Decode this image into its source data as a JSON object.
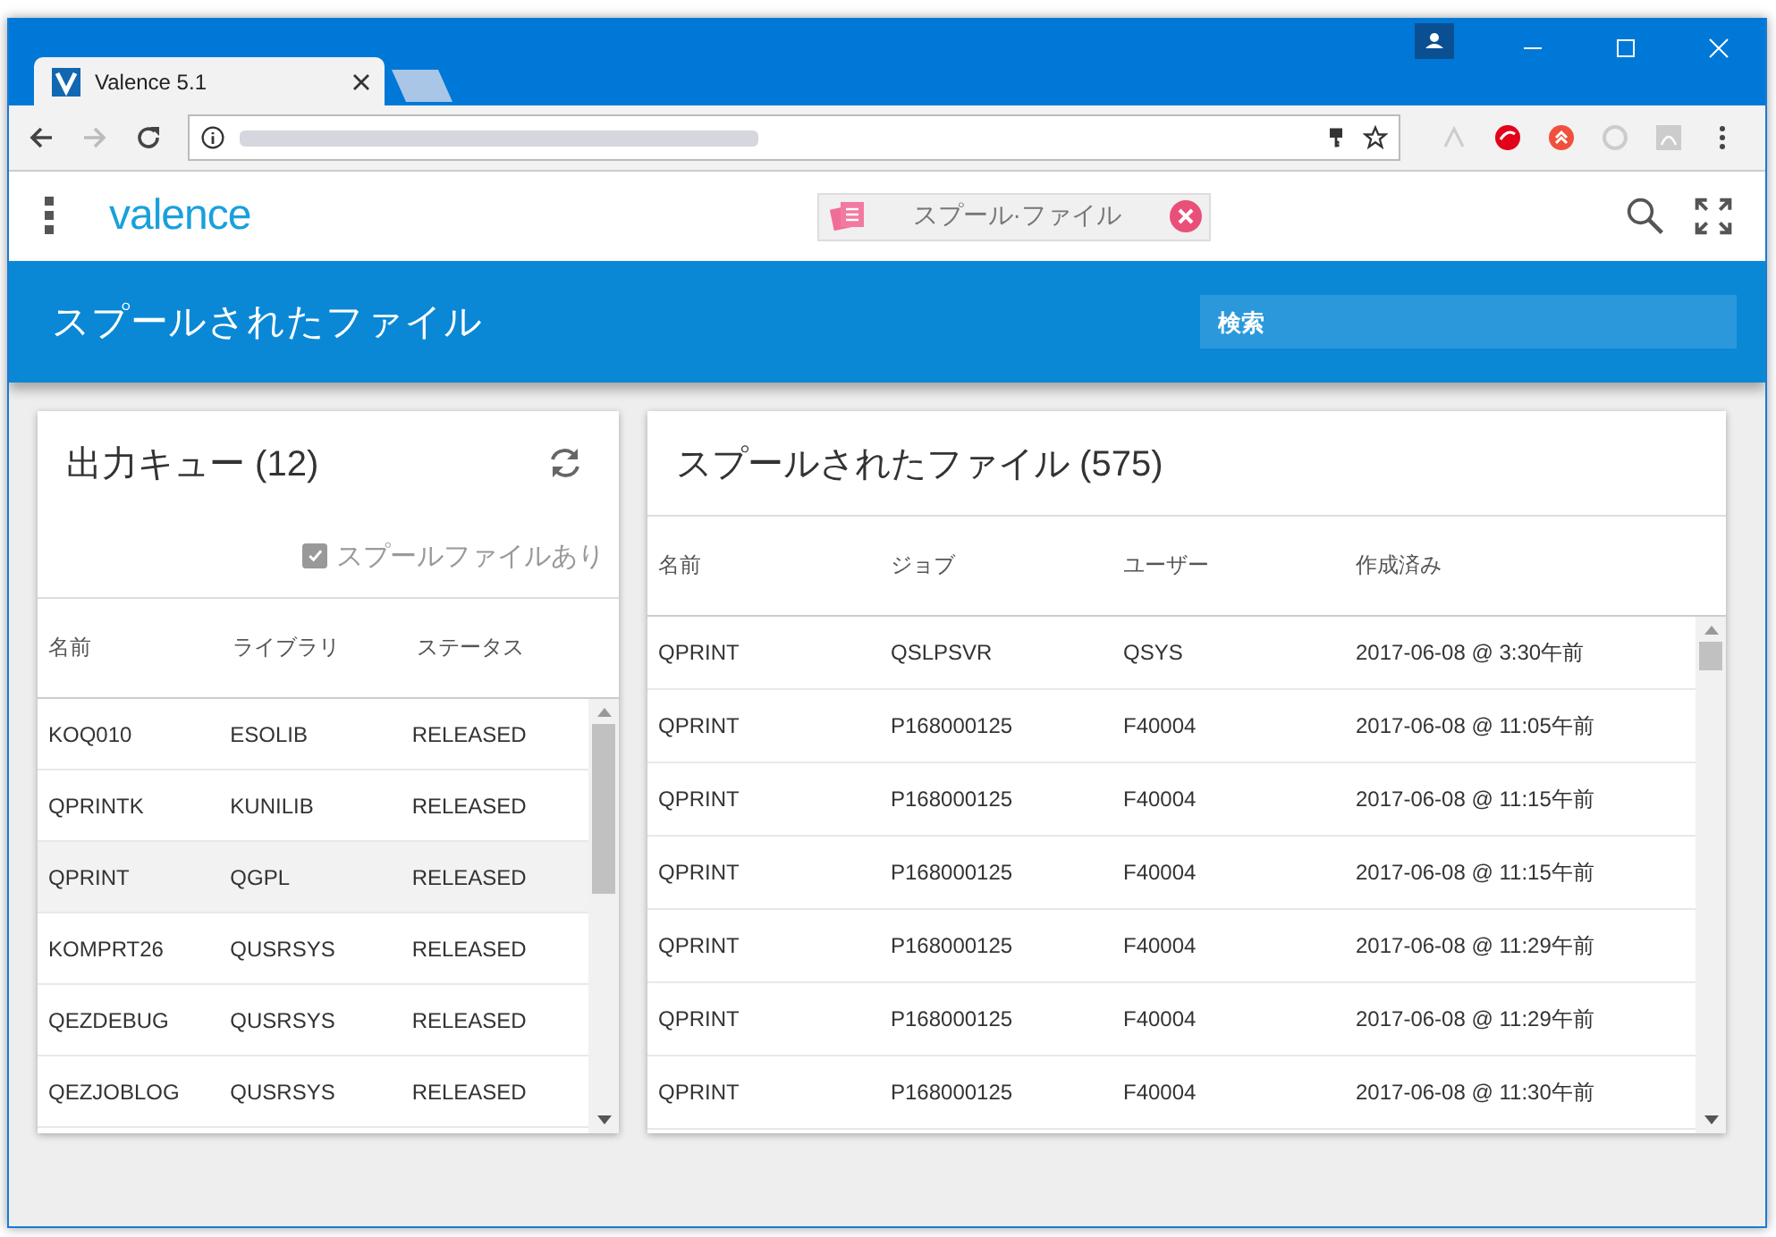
{
  "browser": {
    "tab_title": "Valence 5.1"
  },
  "app": {
    "logo": "valence",
    "active_app": "スプール·ファイル",
    "page_title": "スプールされたファイル",
    "search": {
      "placeholder": "検索"
    }
  },
  "queue_panel": {
    "title": "出力キュー (12)",
    "filter": {
      "label": "スプールファイルあり",
      "checked": true
    },
    "columns": [
      "名前",
      "ライブラリ",
      "ステータス"
    ],
    "rows": [
      {
        "cells": [
          "KOQ010",
          "ESOLIB",
          "RELEASED"
        ],
        "selected": false
      },
      {
        "cells": [
          "QPRINTK",
          "KUNILIB",
          "RELEASED"
        ],
        "selected": false
      },
      {
        "cells": [
          "QPRINT",
          "QGPL",
          "RELEASED"
        ],
        "selected": true
      },
      {
        "cells": [
          "KOMPRT26",
          "QUSRSYS",
          "RELEASED"
        ],
        "selected": false
      },
      {
        "cells": [
          "QEZDEBUG",
          "QUSRSYS",
          "RELEASED"
        ],
        "selected": false
      },
      {
        "cells": [
          "QEZJOBLOG",
          "QUSRSYS",
          "RELEASED"
        ],
        "selected": false
      }
    ]
  },
  "files_panel": {
    "title": "スプールされたファイル (575)",
    "columns": [
      "名前",
      "ジョブ",
      "ユーザー",
      "作成済み"
    ],
    "rows": [
      {
        "cells": [
          "QPRINT",
          "QSLPSVR",
          "QSYS",
          "2017-06-08 @ 3:30午前"
        ]
      },
      {
        "cells": [
          "QPRINT",
          "P168000125",
          "F40004",
          "2017-06-08 @ 11:05午前"
        ]
      },
      {
        "cells": [
          "QPRINT",
          "P168000125",
          "F40004",
          "2017-06-08 @ 11:15午前"
        ]
      },
      {
        "cells": [
          "QPRINT",
          "P168000125",
          "F40004",
          "2017-06-08 @ 11:15午前"
        ]
      },
      {
        "cells": [
          "QPRINT",
          "P168000125",
          "F40004",
          "2017-06-08 @ 11:29午前"
        ]
      },
      {
        "cells": [
          "QPRINT",
          "P168000125",
          "F40004",
          "2017-06-08 @ 11:29午前"
        ]
      },
      {
        "cells": [
          "QPRINT",
          "P168000125",
          "F40004",
          "2017-06-08 @ 11:30午前"
        ]
      }
    ]
  }
}
